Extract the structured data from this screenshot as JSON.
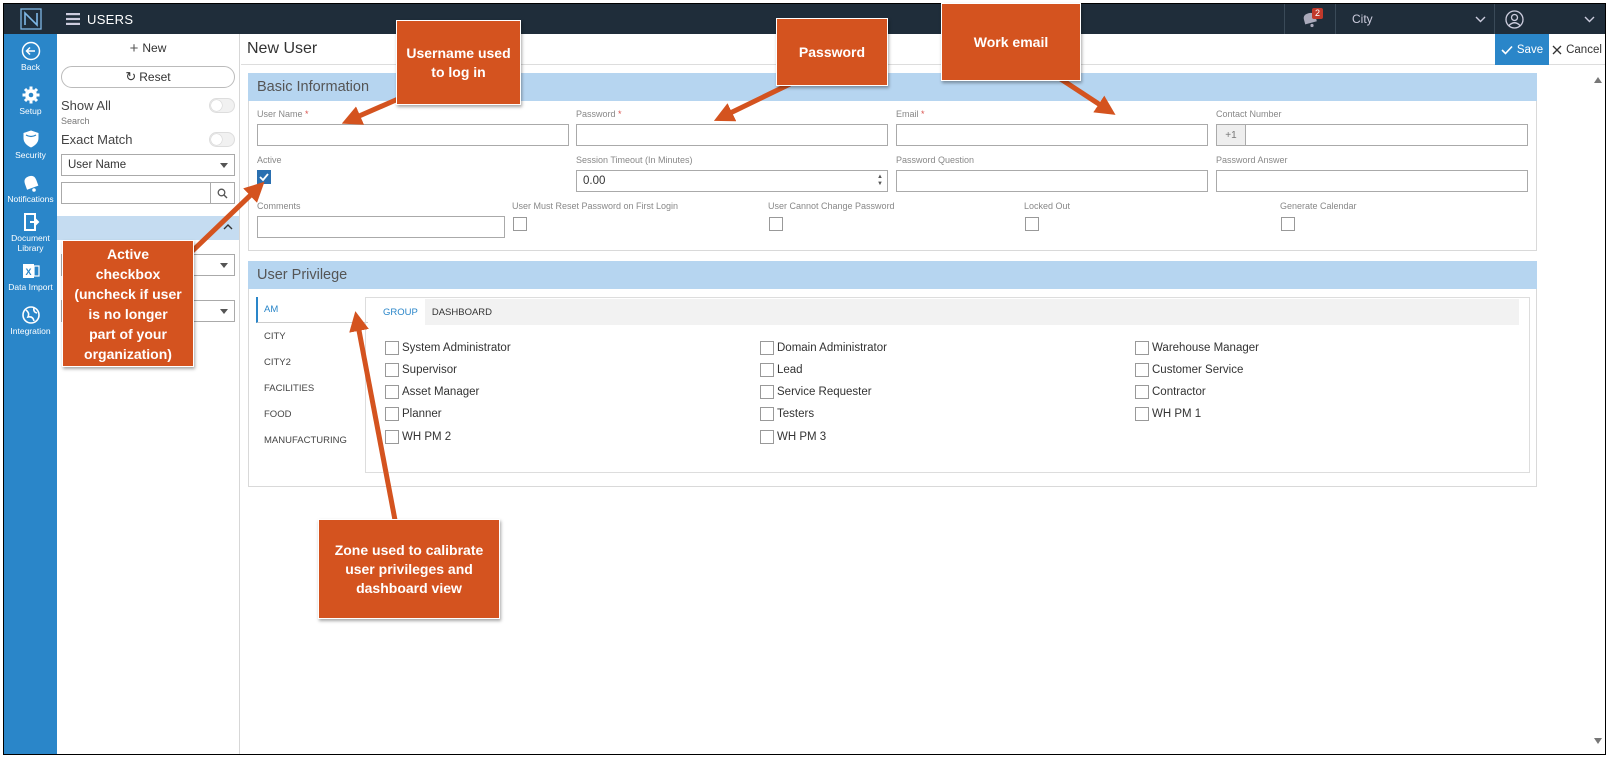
{
  "app": {
    "module_title": "USERS",
    "notification_count": "2",
    "city_selector": "City"
  },
  "rail": [
    {
      "label": "Back",
      "icon": "back-icon"
    },
    {
      "label": "Setup",
      "icon": "gear-icon"
    },
    {
      "label": "Security",
      "icon": "shield-icon"
    },
    {
      "label": "Notifications",
      "icon": "bell-icon"
    },
    {
      "label_line1": "Document",
      "label_line2": "Library",
      "icon": "document-library-icon"
    },
    {
      "label": "Data Import",
      "icon": "excel-icon"
    },
    {
      "label": "Integration",
      "icon": "globe-icon"
    }
  ],
  "filter": {
    "new_label": "New",
    "reset_label": "Reset",
    "show_all_label": "Show All",
    "search_label": "Search",
    "exact_match_label": "Exact Match",
    "field_select_value": "User Name",
    "search_value": ""
  },
  "main": {
    "page_title": "New User",
    "save_label": "Save",
    "cancel_label": "Cancel"
  },
  "basic": {
    "title": "Basic Information",
    "user_name_label": "User Name",
    "password_label": "Password",
    "email_label": "Email",
    "contact_label": "Contact Number",
    "contact_prefix": "+1",
    "active_label": "Active",
    "active_checked": true,
    "session_timeout_label": "Session Timeout (In Minutes)",
    "session_timeout_value": "0.00",
    "password_question_label": "Password Question",
    "password_answer_label": "Password Answer",
    "comments_label": "Comments",
    "must_reset_label": "User Must Reset Password on First Login",
    "cannot_change_label": "User Cannot Change Password",
    "locked_out_label": "Locked Out",
    "generate_calendar_label": "Generate Calendar",
    "required_mark": "*"
  },
  "privilege": {
    "title": "User Privilege",
    "zones": [
      "AM",
      "CITY",
      "CITY2",
      "FACILITIES",
      "FOOD",
      "MANUFACTURING"
    ],
    "active_zone": "AM",
    "tabs": [
      "GROUP",
      "DASHBOARD"
    ],
    "active_tab": "GROUP",
    "groups": [
      [
        "System Administrator",
        "Domain Administrator",
        "Warehouse Manager"
      ],
      [
        "Supervisor",
        "Lead",
        "Customer Service"
      ],
      [
        "Asset Manager",
        "Service Requester",
        "Contractor"
      ],
      [
        "Planner",
        "Testers",
        "WH PM 1"
      ],
      [
        "WH PM 2",
        "WH PM 3"
      ]
    ]
  },
  "callouts": {
    "username": "Username used to log in",
    "password": "Password",
    "email": "Work email",
    "active_l1": "Active",
    "active_l2": "checkbox",
    "active_l3": "(uncheck if user",
    "active_l4": "is no longer",
    "active_l5": "part of your",
    "active_l6": "organization)",
    "zone": "Zone used to calibrate user privileges and dashboard view"
  },
  "colors": {
    "rail": "#2a86c9",
    "topbar": "#1f2d3a",
    "callout": "#d4531f",
    "section_header": "#b6d5f0"
  }
}
